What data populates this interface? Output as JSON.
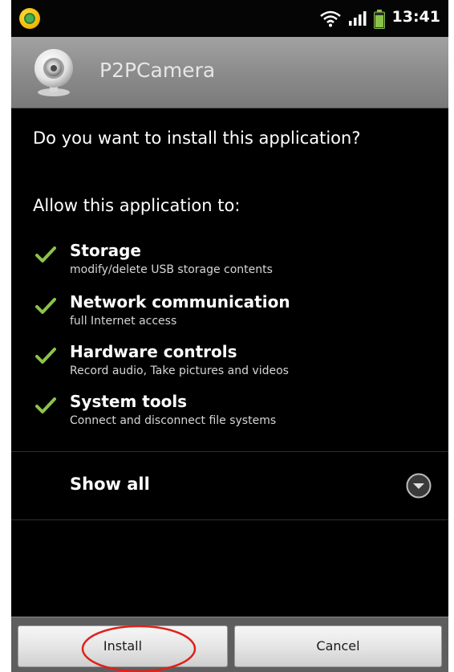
{
  "status_bar": {
    "time": "13:41",
    "icons": [
      "notification-icon",
      "wifi-icon",
      "signal-icon",
      "battery-icon"
    ]
  },
  "title_bar": {
    "app_name": "P2PCamera",
    "icon": "webcam-icon"
  },
  "content": {
    "question": "Do you want to install this application?",
    "allow_heading": "Allow this application to:",
    "permissions": [
      {
        "title": "Storage",
        "description": "modify/delete USB storage contents"
      },
      {
        "title": "Network communication",
        "description": "full Internet access"
      },
      {
        "title": "Hardware controls",
        "description": "Record audio, Take pictures and videos"
      },
      {
        "title": "System tools",
        "description": "Connect and disconnect file systems"
      }
    ],
    "show_all_label": "Show all"
  },
  "buttons": {
    "install_label": "Install",
    "cancel_label": "Cancel"
  },
  "colors": {
    "check_green": "#8bc34a",
    "highlight_circle": "#e0201a",
    "background": "#000000",
    "title_bar": "#8c8c8c"
  }
}
